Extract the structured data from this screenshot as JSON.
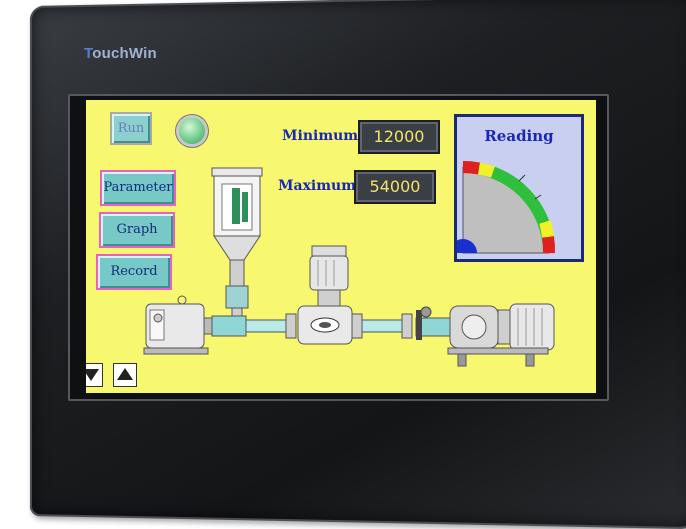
{
  "device": {
    "brand": "TouchWin",
    "brand_first_letter": "T",
    "brand_rest": "ouchWin"
  },
  "hmi": {
    "run_label": "Run",
    "status_lamp": "on",
    "nav_buttons": {
      "parameter": "Parameter",
      "graph": "Graph",
      "record": "Record"
    },
    "minimum_label": "Minimum:",
    "minimum_value": "12000",
    "maximum_label": "Maximum:",
    "maximum_value": "54000",
    "gauge": {
      "title": "Reading",
      "colors": {
        "low_zone": "#e02020",
        "caution_zone": "#f3f02a",
        "normal_zone": "#2fbf3a",
        "needle_hub": "#1a2fd0",
        "dial_face": "#c9cff0"
      }
    },
    "scroll_down_icon": "triangle-down-icon",
    "scroll_up_icon": "triangle-up-icon"
  },
  "colors": {
    "screen_background": "#f8f870",
    "button_face": "#79c8c8",
    "button_border": "#e860c8",
    "label_text": "#1a27b5",
    "value_text": "#f2e46a",
    "pipe_fluid": "#8fd6d6"
  }
}
